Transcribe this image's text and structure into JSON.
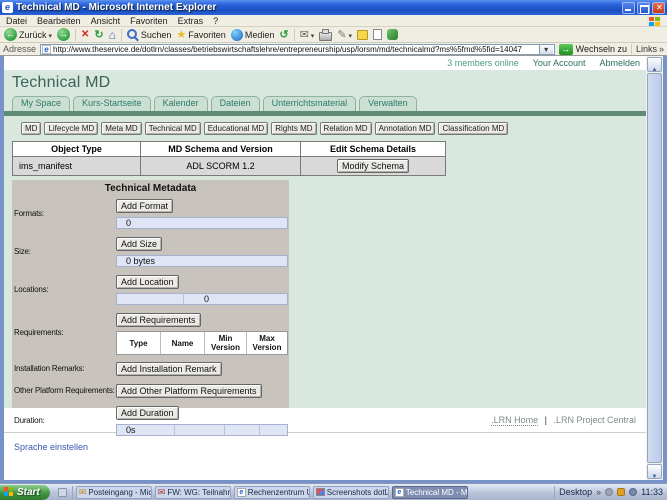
{
  "window": {
    "title": "Technical MD - Microsoft Internet Explorer",
    "menu": [
      "Datei",
      "Bearbeiten",
      "Ansicht",
      "Favoriten",
      "Extras",
      "?"
    ],
    "toolbar": {
      "back": "Zurück",
      "search": "Suchen",
      "favorites": "Favoriten",
      "media": "Medien"
    },
    "address": {
      "label": "Adresse",
      "url": "http://www.theservice.de/dotlrn/classes/betriebswirtschaftslehre/entrepreneurship/usp/lorsm/md/technicalmd?ms%5fmd%5fid=14047",
      "go": "Wechseln zu",
      "links": "Links"
    }
  },
  "page": {
    "userbar": {
      "members_online": "3 members online",
      "your_account": "Your Account",
      "logout": "Abmelden"
    },
    "title": "Technical MD",
    "tabs": [
      "My Space",
      "Kurs-Startseite",
      "Kalender",
      "Dateien",
      "Unterrichtsmaterial",
      "Verwalten"
    ],
    "md_buttons": [
      "MD",
      "Lifecycle MD",
      "Meta MD",
      "Technical MD",
      "Educational MD",
      "Rights MD",
      "Relation MD",
      "Annotation MD",
      "Classification MD"
    ],
    "schema_table": {
      "headers": [
        "Object Type",
        "MD Schema and Version",
        "Edit Schema Details"
      ],
      "object_type": "ims_manifest",
      "schema_version": "ADL SCORM 1.2",
      "modify_button": "Modify Schema"
    },
    "form": {
      "title": "Technical Metadata",
      "formats": {
        "label": "Formats:",
        "button": "Add Format",
        "value": "0"
      },
      "size": {
        "label": "Size:",
        "button": "Add Size",
        "value": "0 bytes"
      },
      "locations": {
        "label": "Locations:",
        "button": "Add Location",
        "value": "0"
      },
      "requirements": {
        "label": "Requirements:",
        "button": "Add Requirements",
        "columns": [
          "Type",
          "Name",
          "Min Version",
          "Max Version"
        ]
      },
      "installation": {
        "label": "Installation Remarks:",
        "button": "Add Installation Remark"
      },
      "other_platform": {
        "label": "Other Platform Requirements:",
        "button": "Add Other Platform Requirements"
      },
      "duration": {
        "label": "Duration:",
        "button": "Add Duration",
        "value": "0s"
      }
    },
    "footer": {
      "lrn_home": ".LRN Home",
      "separator": "|",
      "lrn_project": ".LRN Project Central",
      "language": "Sprache einstellen"
    }
  },
  "taskbar": {
    "start": "Start",
    "tasks": [
      "Posteingang - Micros...",
      "FW: WG: Teilnahme v...",
      "Rechenzentrum Uni K...",
      "Screenshots dotLRN...",
      "Technical MD - Micros..."
    ],
    "desktop": "Desktop",
    "clock": "11:33"
  },
  "colors": {
    "titlebar_blue": "#2a63dc",
    "page_green": "#d9e8de",
    "accent_green_bar": "#5e8c75",
    "blue_row": "#dfe5f4",
    "taskbar_silver": "#b7c2d8"
  }
}
